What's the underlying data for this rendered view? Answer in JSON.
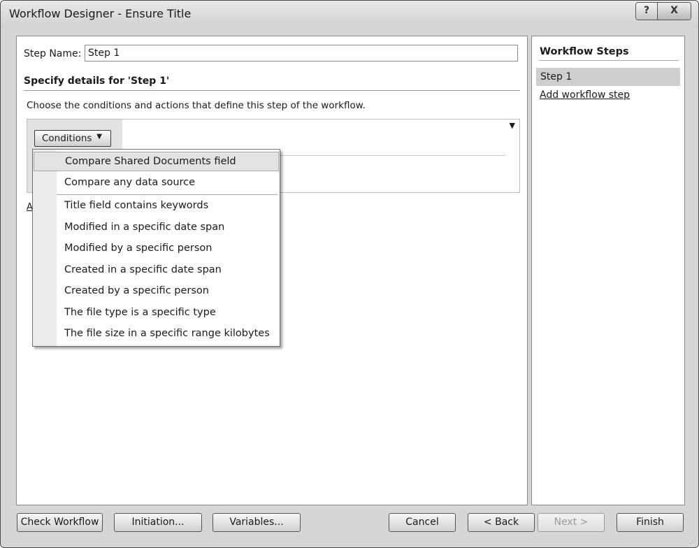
{
  "window": {
    "title": "Workflow Designer - Ensure Title",
    "help_glyph": "?",
    "close_glyph": "X"
  },
  "step": {
    "label": "Step Name:",
    "value": "Step 1"
  },
  "details": {
    "title": "Specify details for 'Step 1'",
    "instructions": "Choose the conditions and actions that define this step of the workflow.",
    "conditions_button": "Conditions",
    "dropdown_arrow": "▼",
    "actions_peek": "A"
  },
  "conditions_menu": {
    "items": [
      "Compare Shared Documents field",
      "Compare any data source",
      "Title field contains keywords",
      "Modified in a specific date span",
      "Modified by a specific person",
      "Created in a specific date span",
      "Created by a specific person",
      "The file type is a specific type",
      "The file size in a specific range kilobytes"
    ]
  },
  "workflow_steps": {
    "title": "Workflow Steps",
    "steps": [
      "Step 1"
    ],
    "add_link": "Add workflow step"
  },
  "footer": {
    "check_workflow": "Check Workflow",
    "initiation": "Initiation...",
    "variables": "Variables...",
    "cancel": "Cancel",
    "back": "< Back",
    "next": "Next >",
    "finish": "Finish"
  }
}
